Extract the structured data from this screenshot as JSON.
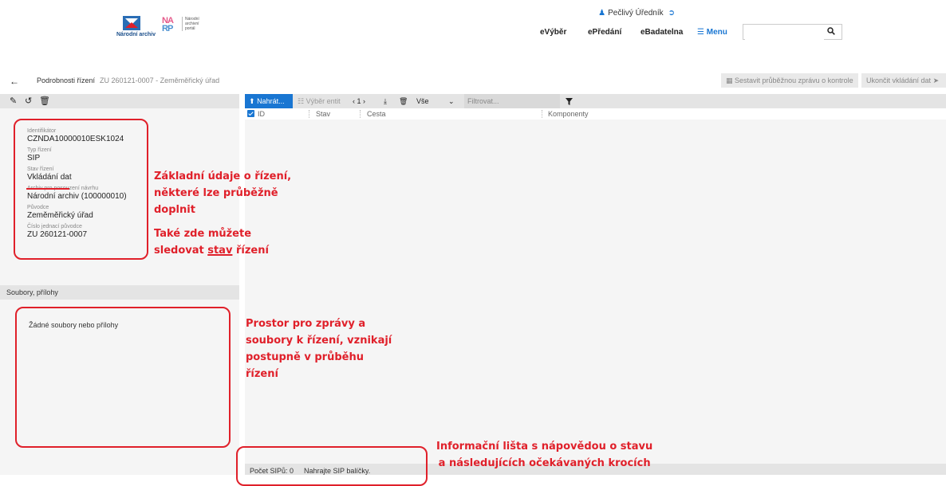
{
  "header": {
    "logo1_text": "Národní archiv",
    "logo2_letters_top": "NA",
    "logo2_letters_bottom": "RP",
    "logo2_side": [
      "Národní",
      "archivní",
      "portál"
    ],
    "nav": [
      "eVýběr",
      "ePředání",
      "eBadatelna"
    ],
    "menu_label": "☰ Menu",
    "user_name": "Pečlivý Úředník",
    "search_value": ""
  },
  "breadcrumb": {
    "main": "Podrobnosti řízení",
    "sub": "ZU 260121-0007 - Zeměměřický úřad"
  },
  "actions": {
    "report_label": "Sestavit průběžnou zprávu o kontrole",
    "finish_label": "Ukončit vkládání dat"
  },
  "details": [
    {
      "label": "Identifikátor",
      "value": "CZNDA10000010ESK1024"
    },
    {
      "label": "Typ řízení",
      "value": "SIP"
    },
    {
      "label": "Stav řízení",
      "value": "Vkládání dat"
    },
    {
      "label": "Archiv pro posouzení návrhu",
      "value": "Národní archiv (100000010)"
    },
    {
      "label": "Původce",
      "value": "Zeměměřický úřad"
    },
    {
      "label": "Číslo jednací původce",
      "value": "ZU 260121-0007"
    }
  ],
  "files": {
    "header": "Soubory, přílohy",
    "empty_text": "Žádné soubory nebo přílohy"
  },
  "toolbar": {
    "upload_label": "Nahrát...",
    "select_entities_label": "Výběr entit",
    "pager": "‹ 1 ›",
    "scope_label": "Vše",
    "filter_placeholder": "Filtrovat..."
  },
  "table": {
    "columns": [
      "ID",
      "Stav",
      "Cesta",
      "Komponenty"
    ]
  },
  "status_bar": {
    "count": "Počet SIPů: 0",
    "hint": "Nahrajte SIP balíčky."
  },
  "annotations": {
    "a1_line1": "Základní údaje o řízení,",
    "a1_line2": "některé lze průběžně",
    "a1_line3": "doplnit",
    "a2_line1": "Také zde můžete",
    "a2_line2a": "sledovat ",
    "a2_line2b": "stav",
    "a2_line2c": " řízení",
    "a3_line1": "Prostor pro zprávy a",
    "a3_line2": "soubory k řízení, vznikají",
    "a3_line3": "postupně v průběhu",
    "a3_line4": "řízení",
    "a4_line1": "Informační lišta s nápovědou o stavu",
    "a4_line2": "a následujících očekávaných krocích"
  },
  "colors": {
    "accent": "#1976d2",
    "annotation": "#e0202a",
    "panel_bg": "#f5f5f5",
    "toolbar_bg": "#e4e4e4"
  }
}
